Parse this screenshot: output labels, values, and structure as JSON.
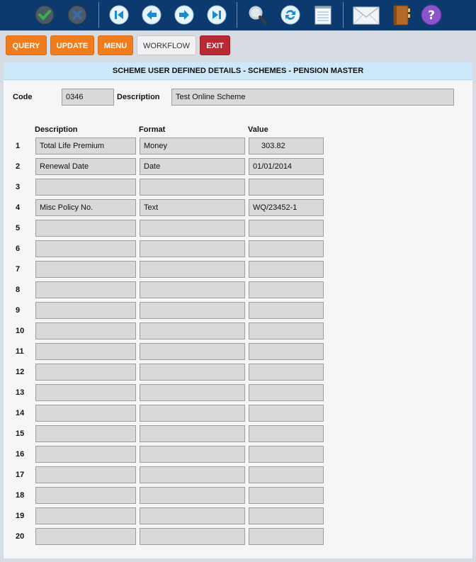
{
  "toolbar": {
    "buttons": [
      {
        "icon": "check-icon"
      },
      {
        "icon": "cancel-icon"
      },
      {
        "icon": "first-record-icon"
      },
      {
        "icon": "previous-record-icon"
      },
      {
        "icon": "next-record-icon"
      },
      {
        "icon": "last-record-icon"
      },
      {
        "icon": "search-icon"
      },
      {
        "icon": "refresh-icon"
      },
      {
        "icon": "notepad-icon"
      },
      {
        "icon": "mail-icon"
      },
      {
        "icon": "address-book-icon"
      },
      {
        "icon": "help-icon"
      }
    ]
  },
  "actions": {
    "query": "QUERY",
    "update": "UPDATE",
    "menu": "MENU",
    "workflow": "WORKFLOW",
    "exit": "EXIT"
  },
  "panel": {
    "title": "SCHEME USER DEFINED DETAILS - SCHEMES - PENSION MASTER",
    "code_label": "Code",
    "code_value": "0346",
    "description_label": "Description",
    "description_value": "Test Online Scheme"
  },
  "table": {
    "columns": [
      "Description",
      "Format",
      "Value"
    ],
    "rows": [
      {
        "num": "1",
        "description": "Total Life Premium",
        "format": "Money",
        "value": "303.82"
      },
      {
        "num": "2",
        "description": "Renewal Date",
        "format": "Date",
        "value": "01/01/2014"
      },
      {
        "num": "3",
        "description": "",
        "format": "",
        "value": ""
      },
      {
        "num": "4",
        "description": "Misc Policy No.",
        "format": "Text",
        "value": "WQ/23452-1"
      },
      {
        "num": "5",
        "description": "",
        "format": "",
        "value": ""
      },
      {
        "num": "6",
        "description": "",
        "format": "",
        "value": ""
      },
      {
        "num": "7",
        "description": "",
        "format": "",
        "value": ""
      },
      {
        "num": "8",
        "description": "",
        "format": "",
        "value": ""
      },
      {
        "num": "9",
        "description": "",
        "format": "",
        "value": ""
      },
      {
        "num": "10",
        "description": "",
        "format": "",
        "value": ""
      },
      {
        "num": "11",
        "description": "",
        "format": "",
        "value": ""
      },
      {
        "num": "12",
        "description": "",
        "format": "",
        "value": ""
      },
      {
        "num": "13",
        "description": "",
        "format": "",
        "value": ""
      },
      {
        "num": "14",
        "description": "",
        "format": "",
        "value": ""
      },
      {
        "num": "15",
        "description": "",
        "format": "",
        "value": ""
      },
      {
        "num": "16",
        "description": "",
        "format": "",
        "value": ""
      },
      {
        "num": "17",
        "description": "",
        "format": "",
        "value": ""
      },
      {
        "num": "18",
        "description": "",
        "format": "",
        "value": ""
      },
      {
        "num": "19",
        "description": "",
        "format": "",
        "value": ""
      },
      {
        "num": "20",
        "description": "",
        "format": "",
        "value": ""
      }
    ]
  },
  "colors": {
    "toolbar_bg": "#0d3a6e",
    "action_orange": "#f07c1e",
    "exit_red": "#b72a33",
    "title_bar_bg": "#cde8f8",
    "field_bg": "#d9d9d9"
  }
}
